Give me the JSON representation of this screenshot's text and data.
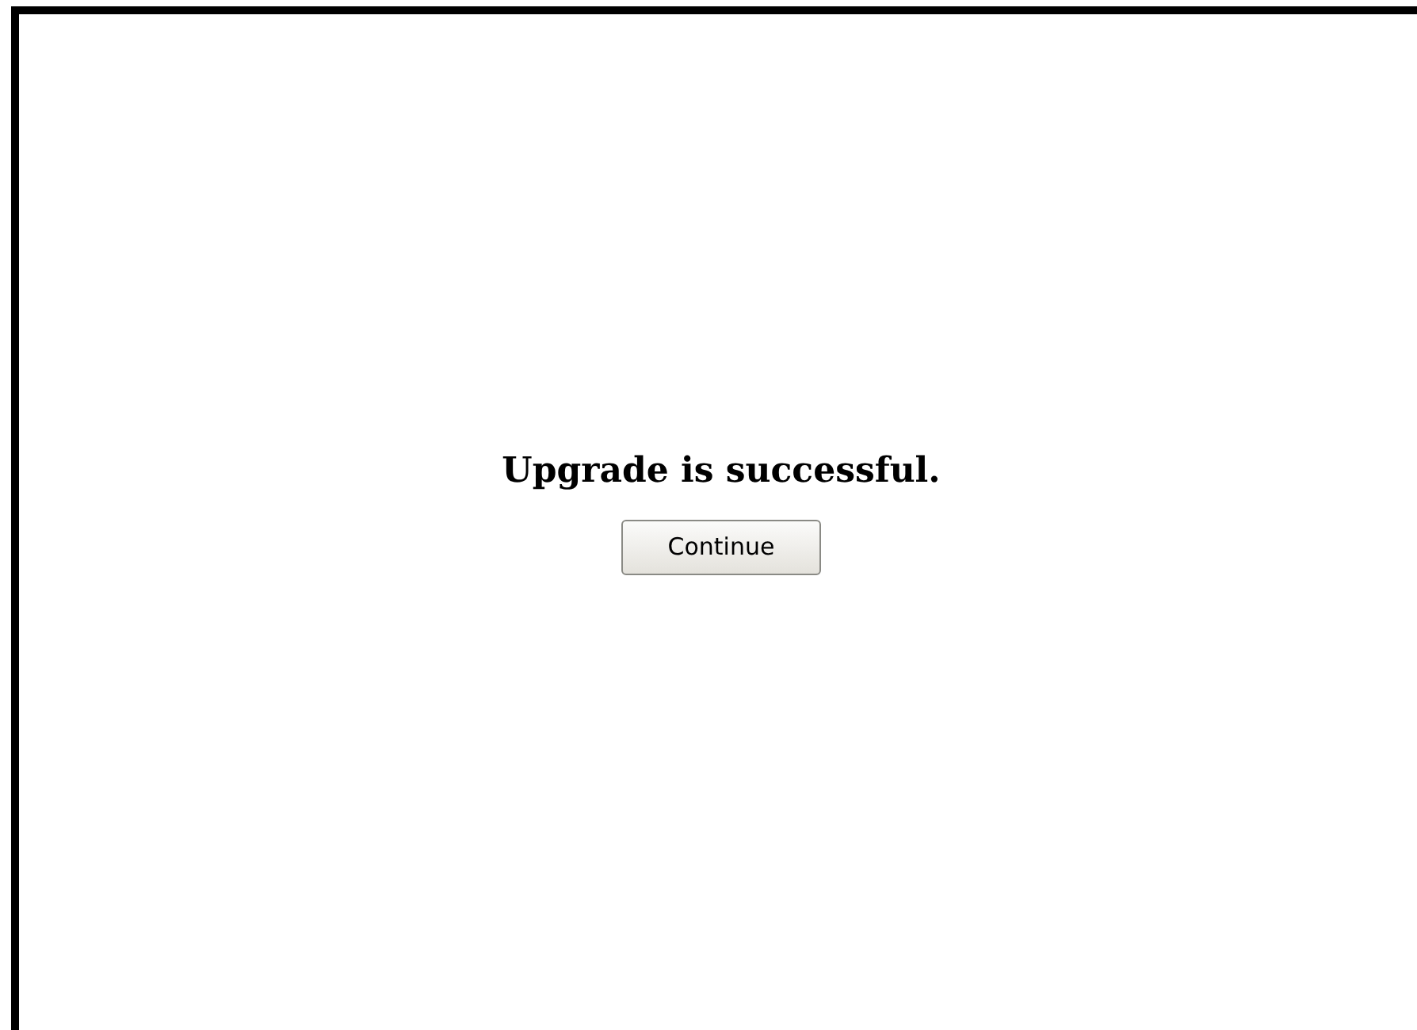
{
  "message": "Upgrade is successful.",
  "buttons": [
    "Continue"
  ]
}
